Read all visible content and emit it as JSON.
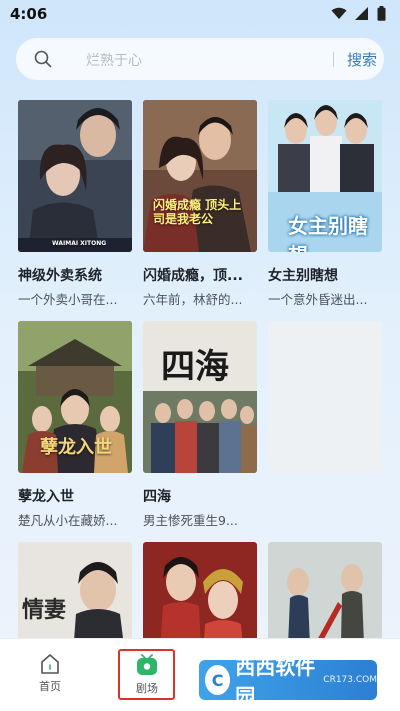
{
  "status_bar": {
    "time": "4:06"
  },
  "search": {
    "placeholder": "烂熟于心",
    "button_label": "搜索"
  },
  "dramas": [
    {
      "title": "神级外卖系统",
      "desc": "一个外卖小哥在...",
      "poster_text": "WAIMAI XITONG"
    },
    {
      "title": "闪婚成瘾，顶...",
      "desc": "六年前，林舒的...",
      "poster_text": "闪婚成瘾 顶头上司是我老公"
    },
    {
      "title": "女主别瞎想",
      "desc": "一个意外昏迷出...",
      "poster_text": "女主别瞎想"
    },
    {
      "title": "孽龙入世",
      "desc": "楚凡从小在藏娇...",
      "poster_text": "孽龙入世"
    },
    {
      "title": "四海",
      "desc": "男主惨死重生9...",
      "poster_text": "四海"
    },
    {
      "title": "",
      "desc": "",
      "poster_text": ""
    },
    {
      "title": "",
      "desc": "",
      "poster_text": "情妻"
    },
    {
      "title": "",
      "desc": "",
      "poster_text": ""
    },
    {
      "title": "",
      "desc": "",
      "poster_text": ""
    }
  ],
  "nav": {
    "home_label": "首页",
    "theater_label": "剧场"
  },
  "watermark": {
    "brand": "西西软件园",
    "url": "CR173.COM"
  },
  "colors": {
    "accent": "#3c78b8",
    "highlight": "#d9342b",
    "active_tab": "#2fb56a"
  }
}
